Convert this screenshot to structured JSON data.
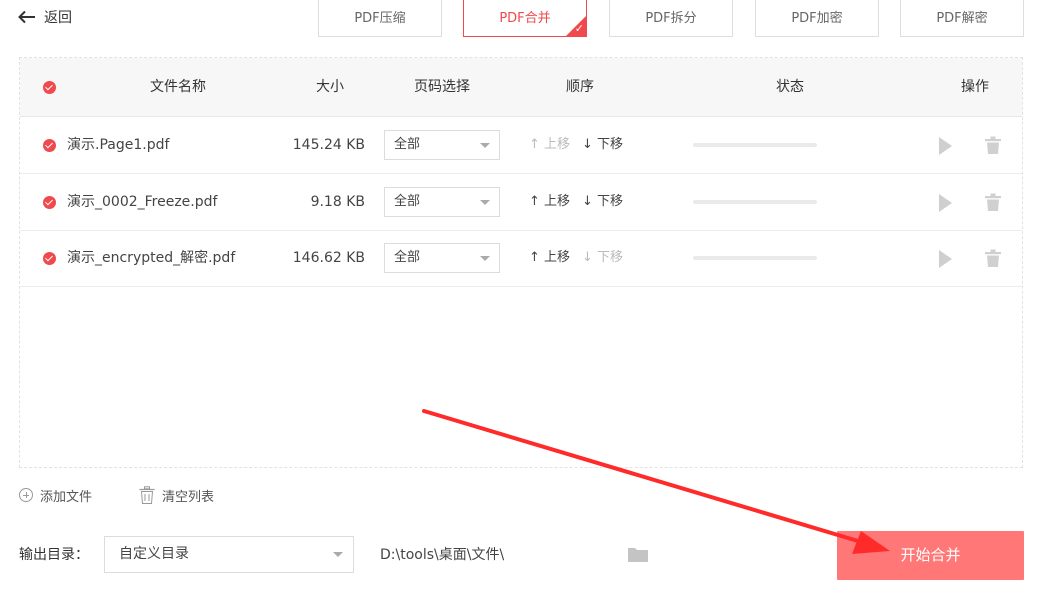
{
  "nav": {
    "back_label": "返回"
  },
  "tabs": [
    {
      "label": "PDF压缩",
      "active": false
    },
    {
      "label": "PDF合并",
      "active": true
    },
    {
      "label": "PDF拆分",
      "active": false
    },
    {
      "label": "PDF加密",
      "active": false
    },
    {
      "label": "PDF解密",
      "active": false
    }
  ],
  "table": {
    "headers": {
      "name": "文件名称",
      "size": "大小",
      "pages": "页码选择",
      "order": "顺序",
      "status": "状态",
      "ops": "操作"
    },
    "rows": [
      {
        "name": "演示.Page1.pdf",
        "size": "145.24 KB",
        "pages": "全部",
        "up": "↑ 上移",
        "down": "↓ 下移",
        "up_enabled": false,
        "down_enabled": true,
        "progress": 0
      },
      {
        "name": "演示_0002_Freeze.pdf",
        "size": "9.18 KB",
        "pages": "全部",
        "up": "↑ 上移",
        "down": "↓ 下移",
        "up_enabled": true,
        "down_enabled": true,
        "progress": 0
      },
      {
        "name": "演示_encrypted_解密.pdf",
        "size": "146.62 KB",
        "pages": "全部",
        "up": "↑ 上移",
        "down": "↓ 下移",
        "up_enabled": true,
        "down_enabled": false,
        "progress": 0
      }
    ]
  },
  "actions": {
    "add_file": "添加文件",
    "clear_list": "清空列表"
  },
  "output": {
    "label": "输出目录：",
    "dir_option": "自定义目录",
    "path": "D:\\tools\\桌面\\文件\\",
    "start_button": "开始合并"
  },
  "colors": {
    "accent": "#f0494e",
    "start_button": "#ff7777",
    "annotation_arrow": "#ff2b2b"
  },
  "icons": [
    "arrow-left-icon",
    "check-circle-icon",
    "caret-down-icon",
    "play-icon",
    "trash-icon",
    "plus-circle-icon",
    "folder-icon"
  ]
}
